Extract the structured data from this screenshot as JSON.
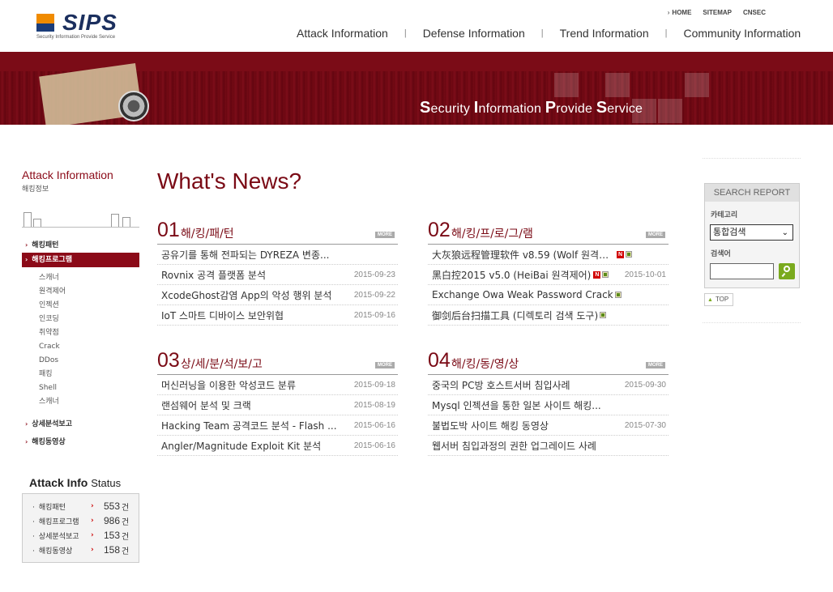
{
  "brand": {
    "name": "SIPS",
    "tagline": "Security Information Provide Service"
  },
  "util_links": [
    "HOME",
    "SITEMAP",
    "CNSEC"
  ],
  "gnb": [
    "Attack Information",
    "Defense Information",
    "Trend Information",
    "Community Information"
  ],
  "banner": {
    "slogan": [
      {
        "cap": "S",
        "rest": "ecurity "
      },
      {
        "cap": "I",
        "rest": "nformation "
      },
      {
        "cap": "P",
        "rest": "rovide "
      },
      {
        "cap": "S",
        "rest": "ervice"
      }
    ]
  },
  "sidebar": {
    "title": "Attack Information",
    "subtitle": "해킹정보",
    "menu": [
      {
        "label": "해킹패턴"
      },
      {
        "label": "해킹프로그램"
      },
      {
        "label": "상세분석보고"
      },
      {
        "label": "해킹동영상"
      }
    ],
    "submenu": [
      "스캐너",
      "원격제어",
      "인젝션",
      "인코딩",
      "취약점",
      "Crack",
      "DDos",
      "패킹",
      "Shell",
      "스캐너"
    ]
  },
  "status": {
    "title_bold": "Attack Info",
    "title_rest": "Status",
    "unit": "건",
    "rows": [
      {
        "label": "해킹패턴",
        "count": "553"
      },
      {
        "label": "해킹프로그램",
        "count": "986"
      },
      {
        "label": "상세분석보고",
        "count": "153"
      },
      {
        "label": "해킹동영상",
        "count": "158"
      }
    ]
  },
  "news_title": "What's News?",
  "more_label": "MORE",
  "boards": [
    {
      "num": "01",
      "title": "해/킹/패/턴",
      "items": [
        {
          "title": "공유기를 통해 전파되는 DYREZA 변종...",
          "date": ""
        },
        {
          "title": "Rovnix 공격 플랫폼 분석",
          "date": "2015-09-23"
        },
        {
          "title": "XcodeGhost감염 App의 악성 행위 분석",
          "date": "2015-09-22"
        },
        {
          "title": "IoT 스마트 디바이스 보안위협",
          "date": "2015-09-16"
        }
      ]
    },
    {
      "num": "02",
      "title": "해/킹/프/로/그/램",
      "items": [
        {
          "title": "大灰狼远程管理软件 v8.59 (Wolf 원격제...",
          "date": "",
          "new": true,
          "file": true
        },
        {
          "title": "黑白控2015 v5.0 (HeiBai 원격제어)",
          "date": "2015-10-01",
          "new": true,
          "file": true
        },
        {
          "title": "Exchange Owa Weak Password Crack",
          "date": "",
          "file": true
        },
        {
          "title": "御剑后台扫描工具 (디렉토리 검색 도구)",
          "date": "",
          "file": true
        }
      ]
    },
    {
      "num": "03",
      "title": "상/세/분/석/보/고",
      "items": [
        {
          "title": "머신러닝을 이용한 악성코드 분류",
          "date": "2015-09-18"
        },
        {
          "title": "랜섬웨어 분석 및 크랙",
          "date": "2015-08-19"
        },
        {
          "title": "Hacking Team 공격코드 분석 - Flash ...",
          "date": "2015-06-16"
        },
        {
          "title": "Angler/Magnitude Exploit Kit 분석",
          "date": "2015-06-16"
        }
      ]
    },
    {
      "num": "04",
      "title": "해/킹/동/영/상",
      "items": [
        {
          "title": "중국의 PC방 호스트서버 침입사례",
          "date": "2015-09-30"
        },
        {
          "title": "Mysql 인젝션을 통한 일본 사이트 해킹...",
          "date": ""
        },
        {
          "title": "불법도박 사이트 해킹 동영상",
          "date": "2015-07-30"
        },
        {
          "title": "웹서버 침입과정의 권한 업그레이드 사례",
          "date": ""
        }
      ]
    }
  ],
  "search": {
    "title": "SEARCH REPORT",
    "category_label": "카테고리",
    "category_value": "통합검색",
    "keyword_label": "검색어",
    "keyword_value": ""
  },
  "top_label": "TOP",
  "colors": {
    "brand_red": "#7a0a15",
    "accent_green": "#7aaa1e"
  }
}
